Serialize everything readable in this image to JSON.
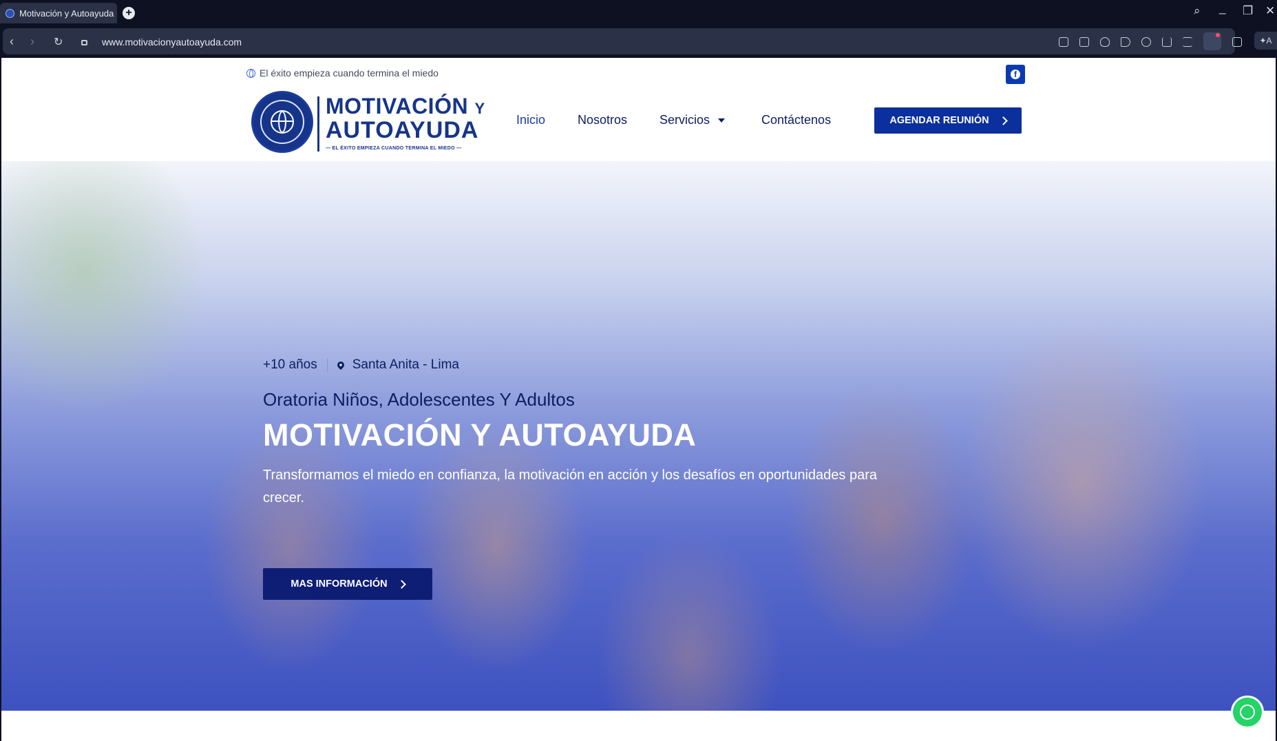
{
  "browser": {
    "tab_title": "Motivación y Autoayuda",
    "new_tab": "+",
    "url": "www.motivacionyautoayuda.com",
    "nav": {
      "back": "‹",
      "forward": "›",
      "reload": "↻"
    },
    "window": {
      "search": "⌕",
      "minimize": "_",
      "restore": "❐",
      "close": "✕"
    },
    "ai_button": "✦A"
  },
  "site": {
    "tagline": "El éxito empieza cuando termina el miedo",
    "social": {
      "facebook": "f"
    },
    "logo": {
      "line1": "MOTIVACIÓN",
      "line1_suffix": "Y",
      "line2": "AUTOAYUDA",
      "line3": "— EL ÉXITO EMPIEZA CUANDO TERMINA EL MIEDO —"
    },
    "menu": {
      "inicio": "Inicio",
      "nosotros": "Nosotros",
      "servicios": "Servicios",
      "contacto": "Contáctenos"
    },
    "cta": "AGENDAR REUNIÓN"
  },
  "hero": {
    "years": "+10 años",
    "location": "Santa Anita - Lima",
    "subtitle": "Oratoria Niños, Adolescentes Y Adultos",
    "title": "MOTIVACIÓN Y AUTOAYUDA",
    "description": "Transformamos el miedo en confianza, la motivación en acción y los desafíos en oportunidades para crecer.",
    "button": "MAS INFORMACIÓN"
  },
  "colors": {
    "brand": "#16358a",
    "cta": "#0b2f9c",
    "hero_button": "#0e1e74",
    "whatsapp": "#25d366"
  }
}
